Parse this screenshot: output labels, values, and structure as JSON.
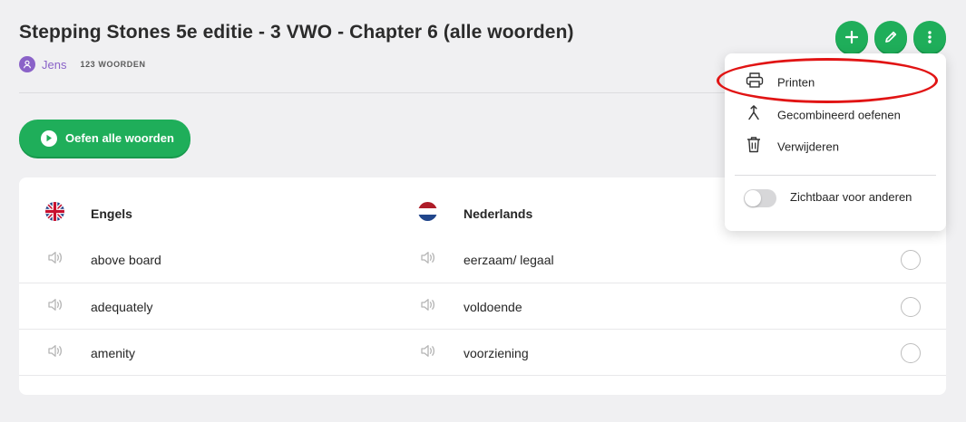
{
  "list": {
    "title": "Stepping Stones 5e editie - 3 VWO - Chapter 6 (alle woorden)",
    "owner": "Jens",
    "word_count": "123 WOORDEN"
  },
  "actions": {
    "practice_all_label": "Oefen alle woorden",
    "add_icon": "plus-icon",
    "edit_icon": "pencil-icon",
    "more_icon": "vertical-dots-icon"
  },
  "table": {
    "source_language": "Engels",
    "target_language": "Nederlands",
    "rows": [
      {
        "source": "above board",
        "target": "eerzaam/ legaal"
      },
      {
        "source": "adequately",
        "target": "voldoende"
      },
      {
        "source": "amenity",
        "target": "voorziening"
      }
    ]
  },
  "menu": {
    "items": [
      {
        "label": "Printen",
        "icon": "printer-icon"
      },
      {
        "label": "Gecombineerd oefenen",
        "icon": "merge-icon"
      },
      {
        "label": "Verwijderen",
        "icon": "trash-icon"
      }
    ],
    "visibility_toggle_label": "Zichtbaar voor anderen",
    "visibility_on": false
  },
  "colors": {
    "accent_green": "#1fae5a",
    "user_purple": "#8a62c8",
    "highlight_red": "#e11414"
  }
}
